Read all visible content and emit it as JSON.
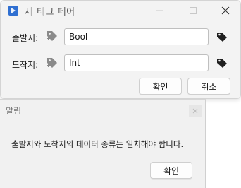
{
  "dialog": {
    "title": "새 태그 페어",
    "source_label": "출발지:",
    "source_value": "Bool",
    "target_label": "도착지:",
    "target_value": "Int",
    "ok_label": "확인",
    "cancel_label": "취소"
  },
  "alert": {
    "title": "알림",
    "message": "출발지와 도착지의 데이터 종류는 일치해야 합니다.",
    "ok_label": "확인"
  },
  "colors": {
    "accent": "#2f6fd1",
    "tag_gray": "#8a8a8a",
    "tag_dark": "#1f1f1f"
  },
  "icons": {
    "app": "tag-pair-icon",
    "source_tag": "tag-add-icon",
    "target_tag": "tag-add-icon",
    "side_tag": "tag-icon"
  }
}
